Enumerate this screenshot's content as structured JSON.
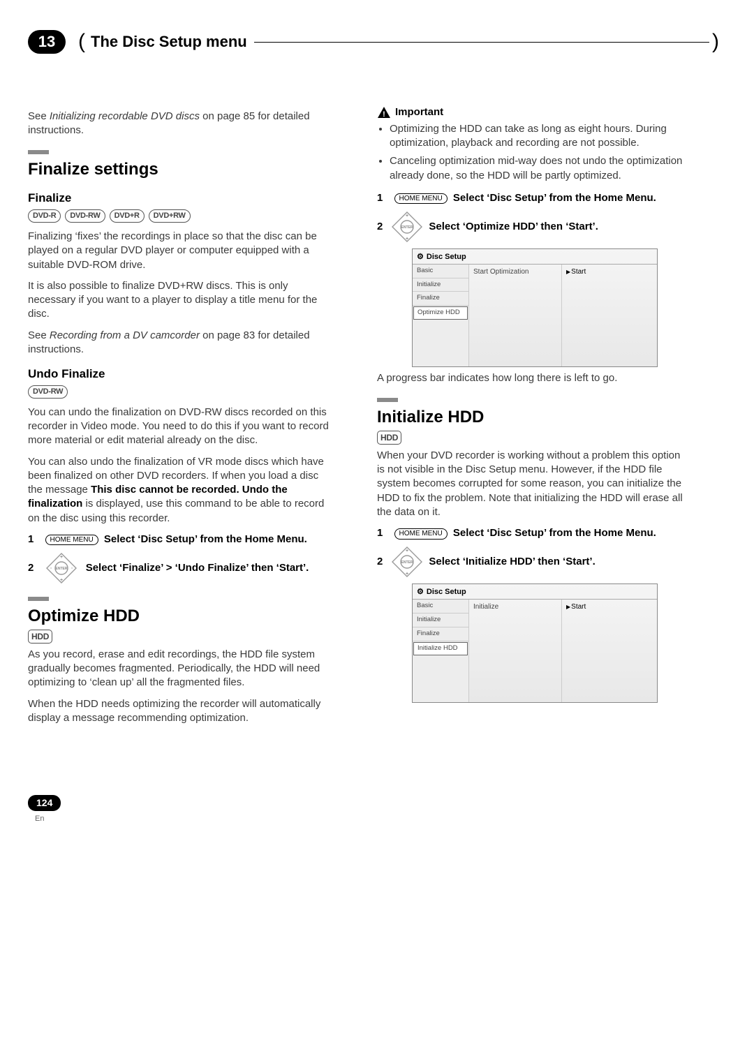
{
  "chapter": {
    "number": "13",
    "title": "The Disc Setup menu"
  },
  "left": {
    "intro_prefix": "See ",
    "intro_ref": "Initializing recordable DVD discs",
    "intro_suffix": " on page 85 for detailed instructions.",
    "finalize_settings_heading": "Finalize settings",
    "finalize_heading": "Finalize",
    "finalize_discs": [
      "DVD-R",
      "DVD-RW",
      "DVD+R",
      "DVD+RW"
    ],
    "finalize_p1": "Finalizing ‘fixes’ the recordings in place so that the disc can be played on a regular DVD player or computer equipped with a suitable DVD-ROM drive.",
    "finalize_p2": "It is also possible to finalize DVD+RW discs. This is only necessary if you want to a player to display a title menu for the disc.",
    "finalize_see_prefix": "See ",
    "finalize_see_ref": "Recording from a DV camcorder",
    "finalize_see_suffix": " on page 83 for detailed instructions.",
    "undo_heading": "Undo Finalize",
    "undo_disc": "DVD-RW",
    "undo_p1": "You can undo the finalization on DVD-RW discs recorded on this recorder in Video mode. You need to do this if you want to record more material or edit material already on the disc.",
    "undo_p2_prefix": "You can also undo the finalization of VR mode discs which have been finalized on other DVD recorders. If when you load a disc the message ",
    "undo_p2_bold": "This disc cannot be recorded. Undo the finalization",
    "undo_p2_suffix": " is displayed, use this command to be able to record on the disc using this recorder.",
    "step1_num": "1",
    "home_menu_label": "HOME MENU",
    "step1_text": "Select ‘Disc Setup’ from the Home Menu.",
    "step2_num": "2",
    "undo_step2_text": "Select ‘Finalize’ > ‘Undo Finalize’ then ‘Start’.",
    "optimize_heading": "Optimize HDD",
    "hdd_badge": "HDD",
    "optimize_p1": "As you record, erase and edit recordings, the HDD file system gradually becomes fragmented. Periodically, the HDD will need optimizing to ‘clean up’ all the fragmented files.",
    "optimize_p2": "When the HDD needs optimizing the recorder will automatically display a message recommending optimization."
  },
  "right": {
    "important_label": "Important",
    "important_b1": "Optimizing the HDD can take as long as eight hours. During optimization, playback and recording are not possible.",
    "important_b2": "Canceling optimization mid-way does not undo the optimization already done, so the HDD will be partly optimized.",
    "step1_num": "1",
    "home_menu_label": "HOME MENU",
    "step1_text": "Select ‘Disc Setup’ from the Home Menu.",
    "step2_num": "2",
    "opt_step2_text": "Select ‘Optimize HDD’ then ‘Start’.",
    "screenshot1": {
      "title": "Disc Setup",
      "sidebar": [
        "Basic",
        "Initialize",
        "Finalize",
        "Optimize HDD"
      ],
      "selected_index": 3,
      "center": "Start Optimization",
      "action": "Start"
    },
    "progress_note": "A progress bar indicates how long there is left to go.",
    "init_heading": "Initialize HDD",
    "hdd_badge": "HDD",
    "init_p1": "When your DVD recorder is working without a problem this option is not visible in the Disc Setup menu. However, if the HDD file system becomes corrupted for some reason, you can initialize the HDD to fix the problem. Note that initializing the HDD will erase all the data on it.",
    "init_step1_num": "1",
    "init_step1_text": "Select ‘Disc Setup’ from the Home Menu.",
    "init_step2_num": "2",
    "init_step2_text": "Select ‘Initialize HDD’ then ‘Start’.",
    "screenshot2": {
      "title": "Disc Setup",
      "sidebar": [
        "Basic",
        "Initialize",
        "Finalize",
        "Initialize HDD"
      ],
      "selected_index": 3,
      "center": "Initialize",
      "action": "Start"
    }
  },
  "footer": {
    "page": "124",
    "lang": "En"
  }
}
